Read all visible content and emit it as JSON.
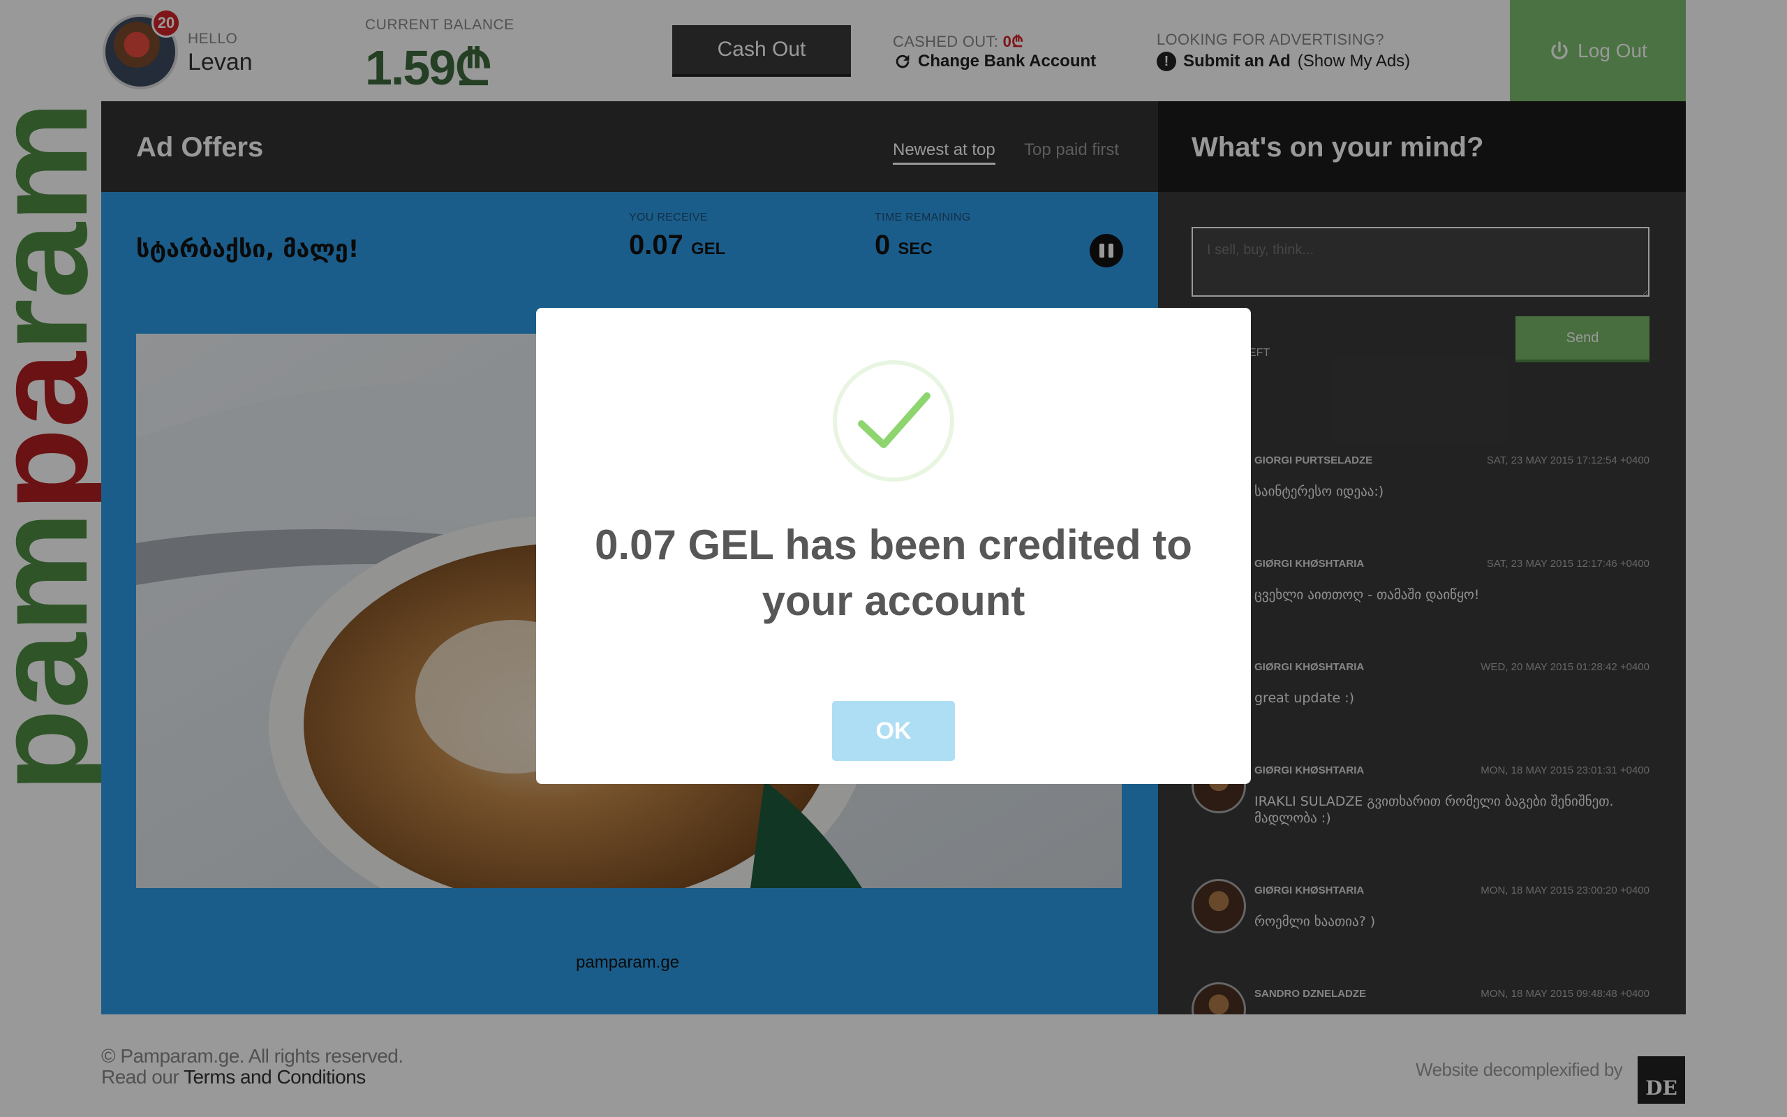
{
  "brand": {
    "logo_text": "pamparam",
    "colors": {
      "green": "#4f8c43",
      "red": "#b31e22"
    }
  },
  "header": {
    "notification_count": "20",
    "hello_label": "HELLO",
    "user_name": "Levan",
    "balance_label": "CURRENT BALANCE",
    "balance_value": "1.59₾",
    "cash_out_label": "Cash Out",
    "cashed_out_label": "CASHED OUT:",
    "cashed_out_value": "0₾",
    "change_bank_label": "Change Bank Account",
    "advertising_label": "LOOKING FOR ADVERTISING?",
    "submit_ad_label": "Submit an Ad",
    "show_my_ads_label": "(Show My Ads)",
    "logout_label": "Log Out"
  },
  "ads": {
    "title": "Ad Offers",
    "sort_newest": "Newest at top",
    "sort_top_paid": "Top paid first",
    "ad_title": "სტარბაქსი, მალე!",
    "receive_label": "YOU RECEIVE",
    "receive_value": "0.07",
    "receive_unit": "GEL",
    "time_label": "TIME REMAINING",
    "time_value": "0",
    "time_unit": "SEC",
    "link": "pamparam.ge",
    "background_color": "#2e9be6"
  },
  "chat": {
    "title": "What's on your mind?",
    "input_placeholder": "I sell, buy, think...",
    "chars_left_label": "EFT",
    "send_label": "Send",
    "posts": [
      {
        "name": "GIORGI PURTSELADZE",
        "date": "SAT, 23 MAY 2015 17:12:54 +0400",
        "text": "საინტერესო იდეაა:)"
      },
      {
        "name": "GIØRGI KHØSHTARIA",
        "date": "SAT, 23 MAY 2015 12:17:46 +0400",
        "text": "ცვეხლი აითთოღ - თამაში დაიწყო!"
      },
      {
        "name": "GIØRGI KHØSHTARIA",
        "date": "WED, 20 MAY 2015 01:28:42 +0400",
        "text": "great update :)"
      },
      {
        "name": "GIØRGI KHØSHTARIA",
        "date": "MON, 18 MAY 2015 23:01:31 +0400",
        "text": "IRAKLI SULADZE გვითხარით რომელი ბაგები შენიშნეთ. მადლობა :)"
      },
      {
        "name": "GIØRGI KHØSHTARIA",
        "date": "MON, 18 MAY 2015 23:00:20 +0400",
        "text": "როემლი ხაათია? )"
      },
      {
        "name": "SANDRO DZNELADZE",
        "date": "MON, 18 MAY 2015 09:48:48 +0400",
        "text": ""
      }
    ]
  },
  "footer": {
    "copyright": "© Pamparam.ge. All rights reserved.",
    "read_our": "Read our",
    "terms_link": "Terms and Conditions",
    "decomplexified": "Website decomplexified by",
    "decomp_logo": "DE"
  },
  "modal": {
    "message": "0.07 GEL has been credited to your account",
    "ok_label": "OK",
    "check_color": "#8ed56f",
    "ok_color": "#aedef4"
  }
}
